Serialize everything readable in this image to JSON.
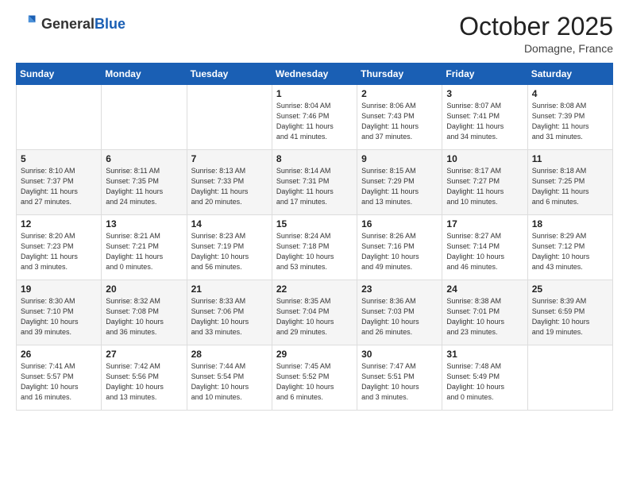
{
  "header": {
    "logo_general": "General",
    "logo_blue": "Blue",
    "month": "October 2025",
    "location": "Domagne, France"
  },
  "weekdays": [
    "Sunday",
    "Monday",
    "Tuesday",
    "Wednesday",
    "Thursday",
    "Friday",
    "Saturday"
  ],
  "weeks": [
    [
      {
        "day": "",
        "info": ""
      },
      {
        "day": "",
        "info": ""
      },
      {
        "day": "",
        "info": ""
      },
      {
        "day": "1",
        "info": "Sunrise: 8:04 AM\nSunset: 7:46 PM\nDaylight: 11 hours\nand 41 minutes."
      },
      {
        "day": "2",
        "info": "Sunrise: 8:06 AM\nSunset: 7:43 PM\nDaylight: 11 hours\nand 37 minutes."
      },
      {
        "day": "3",
        "info": "Sunrise: 8:07 AM\nSunset: 7:41 PM\nDaylight: 11 hours\nand 34 minutes."
      },
      {
        "day": "4",
        "info": "Sunrise: 8:08 AM\nSunset: 7:39 PM\nDaylight: 11 hours\nand 31 minutes."
      }
    ],
    [
      {
        "day": "5",
        "info": "Sunrise: 8:10 AM\nSunset: 7:37 PM\nDaylight: 11 hours\nand 27 minutes."
      },
      {
        "day": "6",
        "info": "Sunrise: 8:11 AM\nSunset: 7:35 PM\nDaylight: 11 hours\nand 24 minutes."
      },
      {
        "day": "7",
        "info": "Sunrise: 8:13 AM\nSunset: 7:33 PM\nDaylight: 11 hours\nand 20 minutes."
      },
      {
        "day": "8",
        "info": "Sunrise: 8:14 AM\nSunset: 7:31 PM\nDaylight: 11 hours\nand 17 minutes."
      },
      {
        "day": "9",
        "info": "Sunrise: 8:15 AM\nSunset: 7:29 PM\nDaylight: 11 hours\nand 13 minutes."
      },
      {
        "day": "10",
        "info": "Sunrise: 8:17 AM\nSunset: 7:27 PM\nDaylight: 11 hours\nand 10 minutes."
      },
      {
        "day": "11",
        "info": "Sunrise: 8:18 AM\nSunset: 7:25 PM\nDaylight: 11 hours\nand 6 minutes."
      }
    ],
    [
      {
        "day": "12",
        "info": "Sunrise: 8:20 AM\nSunset: 7:23 PM\nDaylight: 11 hours\nand 3 minutes."
      },
      {
        "day": "13",
        "info": "Sunrise: 8:21 AM\nSunset: 7:21 PM\nDaylight: 11 hours\nand 0 minutes."
      },
      {
        "day": "14",
        "info": "Sunrise: 8:23 AM\nSunset: 7:19 PM\nDaylight: 10 hours\nand 56 minutes."
      },
      {
        "day": "15",
        "info": "Sunrise: 8:24 AM\nSunset: 7:18 PM\nDaylight: 10 hours\nand 53 minutes."
      },
      {
        "day": "16",
        "info": "Sunrise: 8:26 AM\nSunset: 7:16 PM\nDaylight: 10 hours\nand 49 minutes."
      },
      {
        "day": "17",
        "info": "Sunrise: 8:27 AM\nSunset: 7:14 PM\nDaylight: 10 hours\nand 46 minutes."
      },
      {
        "day": "18",
        "info": "Sunrise: 8:29 AM\nSunset: 7:12 PM\nDaylight: 10 hours\nand 43 minutes."
      }
    ],
    [
      {
        "day": "19",
        "info": "Sunrise: 8:30 AM\nSunset: 7:10 PM\nDaylight: 10 hours\nand 39 minutes."
      },
      {
        "day": "20",
        "info": "Sunrise: 8:32 AM\nSunset: 7:08 PM\nDaylight: 10 hours\nand 36 minutes."
      },
      {
        "day": "21",
        "info": "Sunrise: 8:33 AM\nSunset: 7:06 PM\nDaylight: 10 hours\nand 33 minutes."
      },
      {
        "day": "22",
        "info": "Sunrise: 8:35 AM\nSunset: 7:04 PM\nDaylight: 10 hours\nand 29 minutes."
      },
      {
        "day": "23",
        "info": "Sunrise: 8:36 AM\nSunset: 7:03 PM\nDaylight: 10 hours\nand 26 minutes."
      },
      {
        "day": "24",
        "info": "Sunrise: 8:38 AM\nSunset: 7:01 PM\nDaylight: 10 hours\nand 23 minutes."
      },
      {
        "day": "25",
        "info": "Sunrise: 8:39 AM\nSunset: 6:59 PM\nDaylight: 10 hours\nand 19 minutes."
      }
    ],
    [
      {
        "day": "26",
        "info": "Sunrise: 7:41 AM\nSunset: 5:57 PM\nDaylight: 10 hours\nand 16 minutes."
      },
      {
        "day": "27",
        "info": "Sunrise: 7:42 AM\nSunset: 5:56 PM\nDaylight: 10 hours\nand 13 minutes."
      },
      {
        "day": "28",
        "info": "Sunrise: 7:44 AM\nSunset: 5:54 PM\nDaylight: 10 hours\nand 10 minutes."
      },
      {
        "day": "29",
        "info": "Sunrise: 7:45 AM\nSunset: 5:52 PM\nDaylight: 10 hours\nand 6 minutes."
      },
      {
        "day": "30",
        "info": "Sunrise: 7:47 AM\nSunset: 5:51 PM\nDaylight: 10 hours\nand 3 minutes."
      },
      {
        "day": "31",
        "info": "Sunrise: 7:48 AM\nSunset: 5:49 PM\nDaylight: 10 hours\nand 0 minutes."
      },
      {
        "day": "",
        "info": ""
      }
    ]
  ]
}
